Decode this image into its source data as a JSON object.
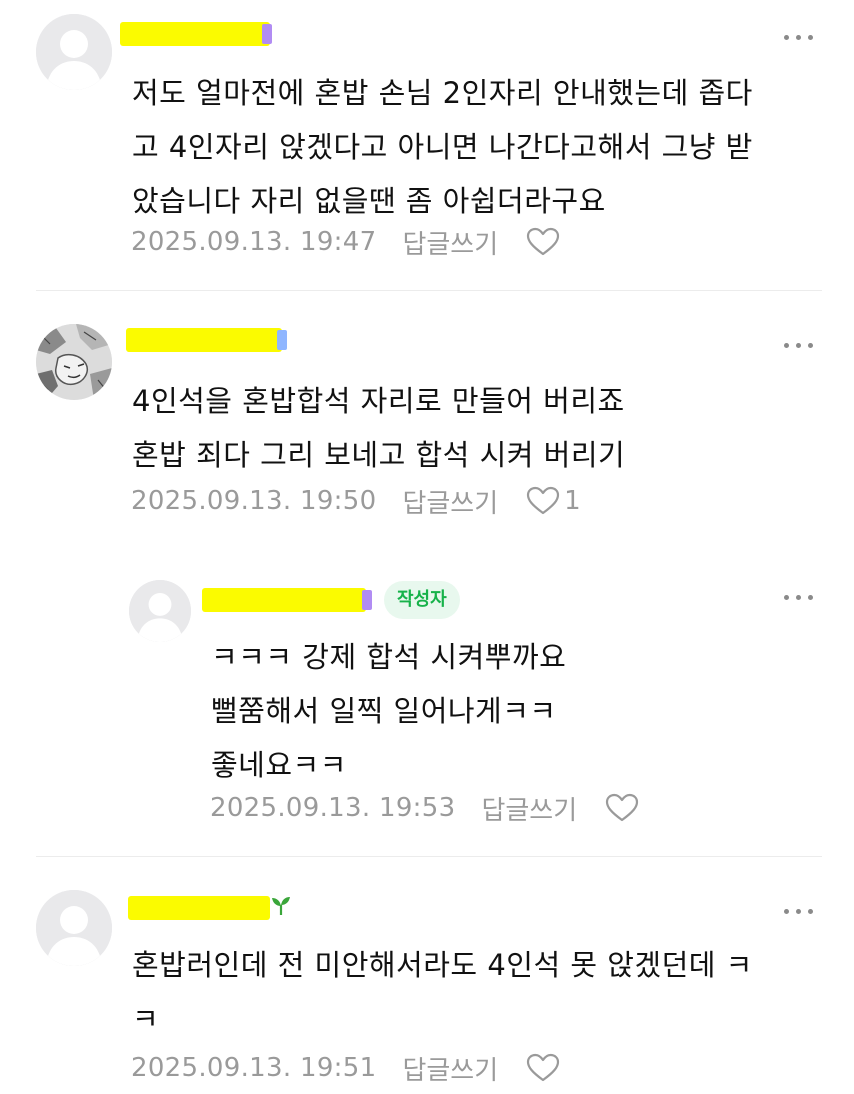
{
  "colors": {
    "name_highlight": "#fbfb00",
    "author_badge_text": "#17b24a",
    "author_badge_bg": "#e8f8ee",
    "meta_text": "#9a9a9a",
    "sprout": "#3aa63a",
    "level_badge_purple": "#b18cf3",
    "level_badge_blue": "#8fb6ff"
  },
  "comments": [
    {
      "lines": [
        "저도 얼마전에 혼밥 손님 2인자리 안내했는데 좁다",
        "고 4인자리 앉겠다고 아니면 나간다고해서 그냥 받",
        "았습니다 자리 없을땐 좀 아쉽더라구요"
      ],
      "date": "2025.09.13. 19:47",
      "reply_label": "답글쓰기",
      "avatar_icon": "default-profile-icon",
      "more_icon": "more-dots-icon",
      "like_icon": "heart-outline-icon"
    },
    {
      "lines": [
        "4인석을 혼밥합석 자리로 만들어 버리죠",
        "혼밥 죄다 그리 보네고 합석 시켜 버리기"
      ],
      "date": "2025.09.13. 19:50",
      "reply_label": "답글쓰기",
      "like_count": "1",
      "avatar_icon": "manga-avatar-image",
      "more_icon": "more-dots-icon",
      "like_icon": "heart-outline-icon"
    },
    {
      "author_badge": "작성자",
      "lines": [
        "ㅋㅋㅋ 강제 합석 시켜뿌까요",
        "뻘쭘해서 일찍 일어나게ㅋㅋ",
        "좋네요ㅋㅋ"
      ],
      "date": "2025.09.13. 19:53",
      "reply_label": "답글쓰기",
      "avatar_icon": "default-profile-icon",
      "more_icon": "more-dots-icon",
      "like_icon": "heart-outline-icon"
    },
    {
      "lines": [
        "혼밥러인데 전 미안해서라도 4인석 못 앉겠던데 ㅋ",
        "ㅋ"
      ],
      "date": "2025.09.13. 19:51",
      "reply_label": "답글쓰기",
      "avatar_icon": "default-profile-icon",
      "level_icon": "sprout-icon",
      "more_icon": "more-dots-icon",
      "like_icon": "heart-outline-icon"
    }
  ]
}
